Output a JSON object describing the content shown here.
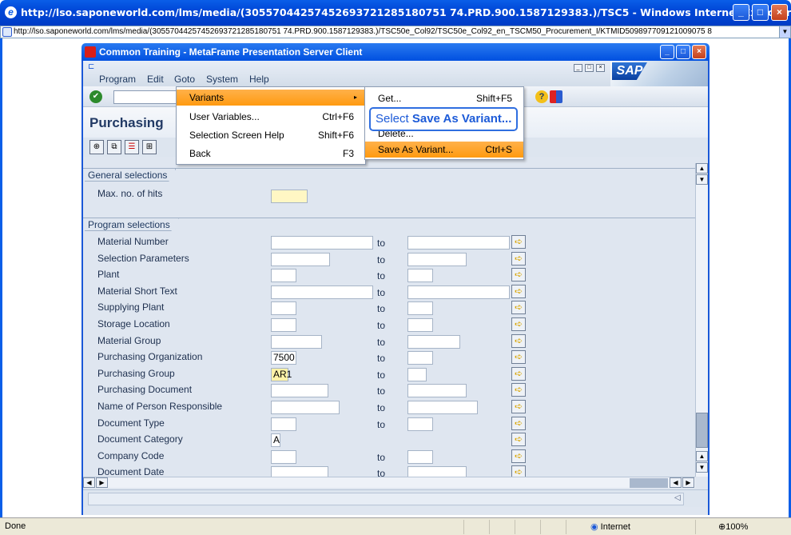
{
  "ie": {
    "title": "http://lso.saponeworld.com/lms/media/(30557044257452693721285180751 74.PRD.900.1587129383.)/TSC5 - Windows Internet Explorer",
    "address": "http://lso.saponeworld.com/lms/media/(30557044257452693721285180751 74.PRD.900.1587129383.)/TSC50e_Col92/TSC50e_Col92_en_TSCM50_Procurement_I/KTMID509897709121009075 8",
    "status_text": "Done",
    "zone": "Internet",
    "zoom": "100%"
  },
  "citrix": {
    "title": "Common Training - MetaFrame Presentation Server Client"
  },
  "menubar": {
    "items": [
      "Program",
      "Edit",
      "Goto",
      "System",
      "Help"
    ]
  },
  "title_area": {
    "title": "Purchasing"
  },
  "groups": {
    "general": {
      "title": "General selections",
      "max_hits_label": "Max. no. of hits"
    },
    "program": {
      "title": "Program selections",
      "to_label": "to"
    }
  },
  "fields": [
    {
      "label": "Material Number",
      "low": "",
      "range": true
    },
    {
      "label": "Selection Parameters",
      "low": "",
      "range": true
    },
    {
      "label": "Plant",
      "low": "",
      "range": true
    },
    {
      "label": "Material Short Text",
      "low": "",
      "range": true
    },
    {
      "label": "Supplying Plant",
      "low": "",
      "range": true
    },
    {
      "label": "Storage Location",
      "low": "",
      "range": true
    },
    {
      "label": "Material Group",
      "low": "",
      "range": true
    },
    {
      "label": "Purchasing Organization",
      "low": "7500",
      "range": true
    },
    {
      "label": "Purchasing Group",
      "low": "AR1",
      "range": true
    },
    {
      "label": "Purchasing Document",
      "low": "",
      "range": true
    },
    {
      "label": "Name of Person Responsible",
      "low": "",
      "range": true
    },
    {
      "label": "Document Type",
      "low": "",
      "range": true
    },
    {
      "label": "Document Category",
      "low": "A",
      "range": false
    },
    {
      "label": "Company Code",
      "low": "",
      "range": true
    },
    {
      "label": "Document Date",
      "low": "",
      "range": true
    }
  ],
  "goto_menu": [
    {
      "label": "Variants",
      "shortcut": "",
      "submenu": true
    },
    {
      "label": "User Variables...",
      "shortcut": "Ctrl+F6"
    },
    {
      "label": "Selection Screen Help",
      "shortcut": "Shift+F6"
    },
    {
      "label": "Back",
      "shortcut": "F3"
    }
  ],
  "variants_menu": [
    {
      "label": "Get...",
      "shortcut": "Shift+F5"
    },
    {
      "label": "Delete...",
      "shortcut": ""
    },
    {
      "label": "Save As Variant...",
      "shortcut": "Ctrl+S"
    }
  ],
  "callout": {
    "prefix": "Select ",
    "bold": "Save As Variant..."
  },
  "logo": {
    "text": "SAP"
  },
  "colors": {
    "highlight": "#ff9a10",
    "title_blue": "#0a5ee8"
  }
}
